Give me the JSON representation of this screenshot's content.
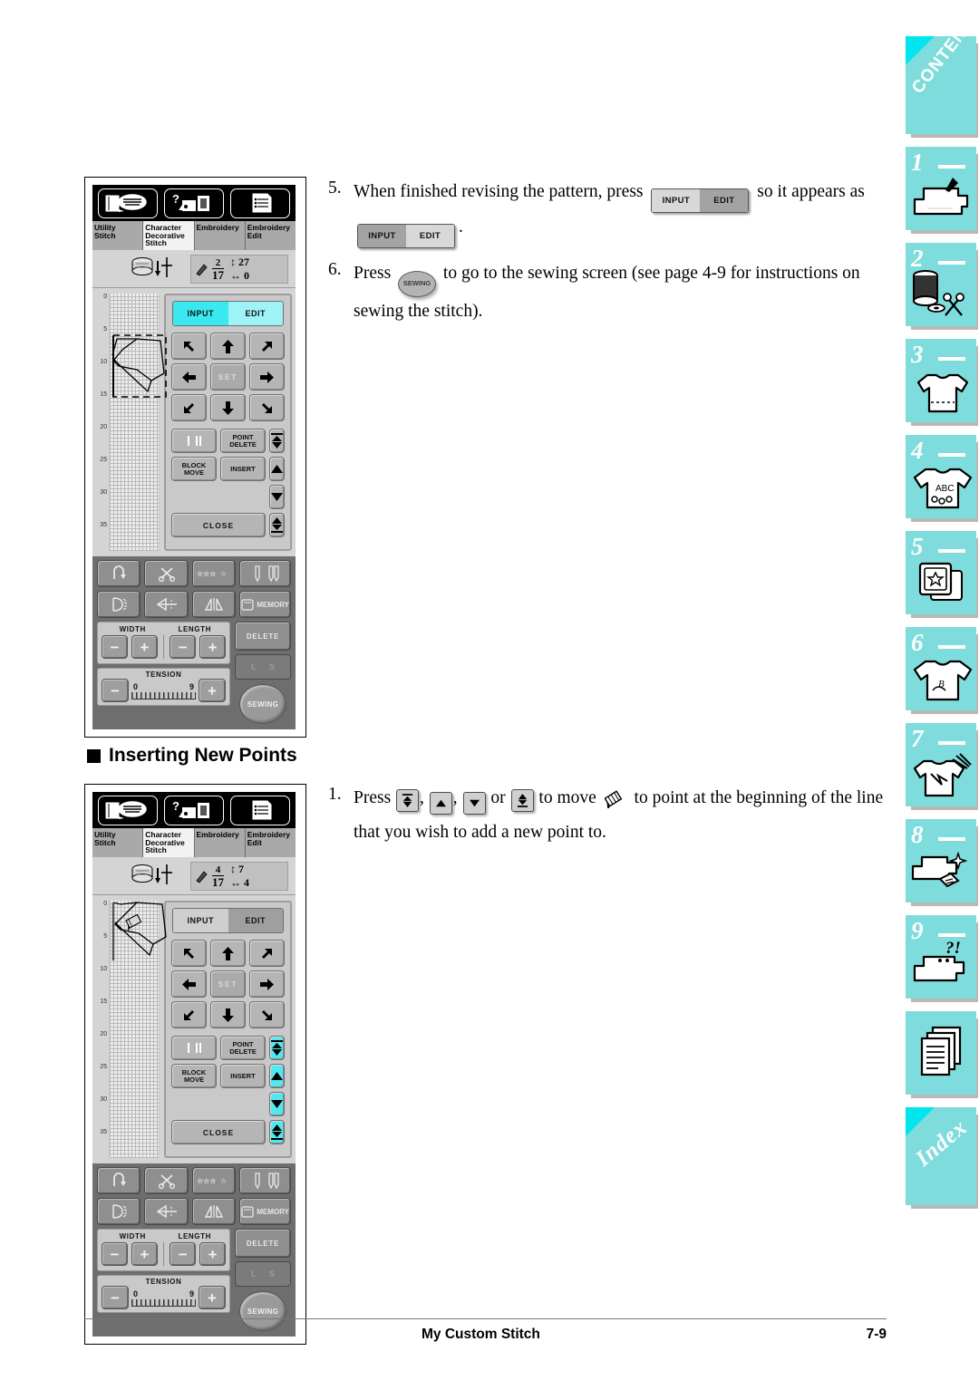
{
  "document": {
    "footer_title": "My Custom Stitch",
    "page_number": "7-9",
    "section_heading": "Inserting New Points"
  },
  "side_tabs": [
    {
      "name": "contents",
      "label": "CONTENTS",
      "number": ""
    },
    {
      "name": "chapter-1",
      "label": "",
      "number": "1"
    },
    {
      "name": "chapter-2",
      "label": "",
      "number": "2"
    },
    {
      "name": "chapter-3",
      "label": "",
      "number": "3"
    },
    {
      "name": "chapter-4",
      "label": "",
      "number": "4"
    },
    {
      "name": "chapter-5",
      "label": "",
      "number": "5"
    },
    {
      "name": "chapter-6",
      "label": "",
      "number": "6"
    },
    {
      "name": "chapter-7",
      "label": "",
      "number": "7"
    },
    {
      "name": "chapter-8",
      "label": "",
      "number": "8"
    },
    {
      "name": "chapter-9",
      "label": "",
      "number": "9"
    },
    {
      "name": "appendix",
      "label": "",
      "number": ""
    },
    {
      "name": "index",
      "label": "Index",
      "number": ""
    }
  ],
  "steps": [
    {
      "number": "5.",
      "text_before": "When finished revising the pattern, press",
      "text_middle": "so it appears as",
      "text_after": ".",
      "toggle_1": {
        "input": "INPUT",
        "edit": "EDIT",
        "active": "EDIT"
      },
      "toggle_2": {
        "input": "INPUT",
        "edit": "EDIT",
        "active": "INPUT"
      }
    },
    {
      "number": "6.",
      "text_before": "Press",
      "button": "SEWING",
      "text_after": "to go to the sewing screen (see page 4-9 for instructions on sewing the stitch)."
    },
    {
      "number": "1.",
      "text_before": "Press",
      "keys": [
        "first-point-icon",
        "previous-point-icon",
        "next-point-icon",
        "last-point-icon"
      ],
      "separator": "or",
      "text_middle": "to move",
      "cursor_icon": "pen-cursor-icon",
      "text_after": "to point at the beginning of the line that you wish to add a new point to."
    }
  ],
  "screens": [
    {
      "name": "edit-mode-screen",
      "mode_icons": [
        "utility-stitch-icon",
        "character-decorative-icon",
        "embroidery-list-icon"
      ],
      "tabs": [
        {
          "label": "Utility\nStitch",
          "active": false
        },
        {
          "label": "Character\nDecorative\nStitch",
          "active": true
        },
        {
          "label": "Embroidery",
          "active": false
        },
        {
          "label": "Embroidery\nEdit",
          "active": false
        }
      ],
      "status": {
        "bobbin_icon": "bobbin-thread-icon",
        "pattern_icon": "stitch-pattern-icon",
        "point_current": "2",
        "point_total": "17",
        "vertical_value": "27",
        "horizontal_value": "0"
      },
      "ruler_ticks": [
        "0",
        "5",
        "10",
        "15",
        "20",
        "25",
        "30",
        "35"
      ],
      "toggle": {
        "input": "INPUT",
        "edit": "EDIT",
        "active": "EDIT",
        "style": "cyan"
      },
      "arrow_pad": [
        "up-left-arrow",
        "up-arrow",
        "up-right-arrow",
        "left-arrow",
        "SET",
        "right-arrow",
        "down-left-arrow",
        "down-arrow",
        "down-right-arrow"
      ],
      "set_label": "SET",
      "edit_buttons": {
        "line_type": "line-type-icon",
        "point_delete": "POINT\nDELETE",
        "block_move": "BLOCK\nMOVE",
        "insert": "INSERT",
        "close": "CLOSE"
      },
      "nav_buttons": [
        {
          "name": "first-point",
          "highlighted": false
        },
        {
          "name": "previous-point",
          "highlighted": false
        },
        {
          "name": "next-point",
          "highlighted": false
        },
        {
          "name": "last-point",
          "highlighted": false
        }
      ],
      "selection_box": true,
      "toolbar": {
        "row1": [
          "reverse-stitch-icon",
          "thread-cutter-icon",
          "stitch-quality-icon",
          "needle-mode-icon"
        ],
        "row2": [
          "presser-foot-icon",
          "mirror-image-icon",
          "twin-needle-icon",
          "MEMORY"
        ],
        "memory_label": "MEMORY",
        "width_label": "WIDTH",
        "length_label": "LENGTH",
        "tension_label": "TENSION",
        "tension_min": "0",
        "tension_max": "9",
        "delete_label": "DELETE",
        "ls_left": "L",
        "ls_right": "S",
        "sewing_label": "SEWING",
        "minus": "−",
        "plus": "+"
      }
    },
    {
      "name": "insert-points-screen",
      "mode_icons": [
        "utility-stitch-icon",
        "character-decorative-icon",
        "embroidery-list-icon"
      ],
      "tabs": [
        {
          "label": "Utility\nStitch",
          "active": false
        },
        {
          "label": "Character\nDecorative\nStitch",
          "active": true
        },
        {
          "label": "Embroidery",
          "active": false
        },
        {
          "label": "Embroidery\nEdit",
          "active": false
        }
      ],
      "status": {
        "bobbin_icon": "bobbin-thread-icon",
        "pattern_icon": "stitch-pattern-icon",
        "point_current": "4",
        "point_total": "17",
        "vertical_value": "7",
        "horizontal_value": "4"
      },
      "ruler_ticks": [
        "0",
        "5",
        "10",
        "15",
        "20",
        "25",
        "30",
        "35"
      ],
      "toggle": {
        "input": "INPUT",
        "edit": "EDIT",
        "active": "EDIT",
        "style": "grey"
      },
      "arrow_pad": [
        "up-left-arrow",
        "up-arrow",
        "up-right-arrow",
        "left-arrow",
        "SET",
        "right-arrow",
        "down-left-arrow",
        "down-arrow",
        "down-right-arrow"
      ],
      "set_label": "SET",
      "edit_buttons": {
        "line_type": "line-type-icon",
        "point_delete": "POINT\nDELETE",
        "block_move": "BLOCK\nMOVE",
        "insert": "INSERT",
        "close": "CLOSE"
      },
      "nav_buttons": [
        {
          "name": "first-point",
          "highlighted": true
        },
        {
          "name": "previous-point",
          "highlighted": true
        },
        {
          "name": "next-point",
          "highlighted": true
        },
        {
          "name": "last-point",
          "highlighted": true
        }
      ],
      "selection_box": false,
      "toolbar": {
        "row1": [
          "reverse-stitch-icon",
          "thread-cutter-icon",
          "stitch-quality-icon",
          "needle-mode-icon"
        ],
        "row2": [
          "presser-foot-icon",
          "mirror-image-icon",
          "twin-needle-icon",
          "MEMORY"
        ],
        "memory_label": "MEMORY",
        "width_label": "WIDTH",
        "length_label": "LENGTH",
        "tension_label": "TENSION",
        "tension_min": "0",
        "tension_max": "9",
        "delete_label": "DELETE",
        "ls_left": "L",
        "ls_right": "S",
        "sewing_label": "SEWING",
        "minus": "−",
        "plus": "+"
      }
    }
  ]
}
